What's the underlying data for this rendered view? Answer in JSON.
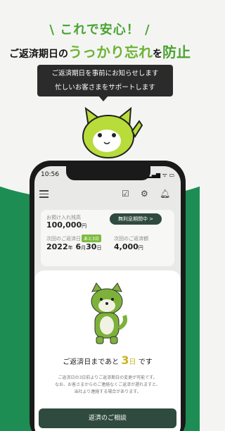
{
  "promo": {
    "headline_top": "\\ これで安心！ /",
    "headline_main_pre": "ご返済期日の",
    "headline_main_accent": "うっかり忘れ",
    "headline_main_mid": "を",
    "headline_main_end": "防止",
    "bubble_line1": "ご返済期日を事前にお知らせします",
    "bubble_line2": "忙しいお客さまをサポートします"
  },
  "status_bar": {
    "time": "10:56",
    "icons": "▂▄▆ ᯤ ▭"
  },
  "card": {
    "balance_label": "お預け入れ残高",
    "balance_value": "100,000",
    "balance_unit": "円",
    "interest_free_button": "無利息期間中 >",
    "next_date_label": "次回のご返済日",
    "days_tag": "あと3日",
    "next_amount_label": "次回のご返済額",
    "date_year": "2022",
    "date_year_unit": "年",
    "date_month": "6",
    "date_month_unit": "月",
    "date_day": "30",
    "date_day_unit": "日",
    "amount_value": "4,000",
    "amount_unit": "円"
  },
  "sheet": {
    "message_pre": "ご返済日まであと",
    "days_value": "3",
    "days_unit": "日",
    "message_post": "です",
    "note_line1": "ご返済日の3日前よりご返済期日の変更が可能です。",
    "note_line2": "なお、お客さまからのご連絡なくご返済が遅れますと、",
    "note_line3": "当社より連絡する場合があります。",
    "cta_label": "返済のご相談"
  },
  "colors": {
    "green": "#1e8d54",
    "accent": "#6db334",
    "dark": "#2f4a3e"
  }
}
